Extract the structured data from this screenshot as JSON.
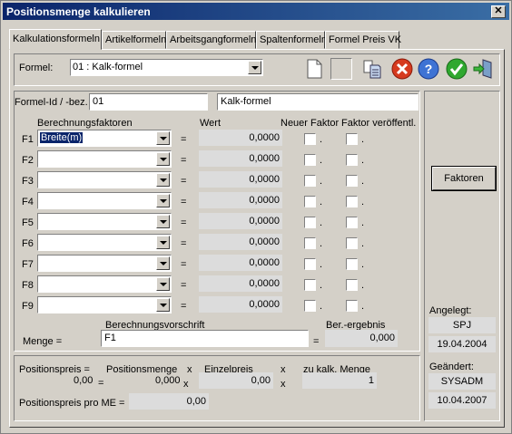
{
  "window": {
    "title": "Positionsmenge kalkulieren",
    "close_symbol": "✕"
  },
  "tabs": [
    {
      "label": "Kalkulationsformeln"
    },
    {
      "label": "Artikelformeln"
    },
    {
      "label": "Arbeitsgangformeln"
    },
    {
      "label": "Spaltenformeln"
    },
    {
      "label": "Formel Preis VK"
    }
  ],
  "formel": {
    "label": "Formel:",
    "value": "01 : Kalk-formel"
  },
  "toolbar": {
    "icons": [
      "new-document-icon",
      "blank-icon",
      "copy-icon",
      "delete-icon",
      "help-icon",
      "confirm-icon",
      "exit-icon"
    ],
    "delete_symbol": "✕",
    "help_symbol": "?",
    "confirm_symbol": "✔"
  },
  "formel_id": {
    "label": "Formel-Id / -bez.",
    "id": "01",
    "bez": "Kalk-formel"
  },
  "headers": {
    "berechnungsfaktoren": "Berechnungsfaktoren",
    "wert": "Wert",
    "neuer_faktor": "Neuer Faktor",
    "faktor_veroeffentl": "Faktor veröffentl."
  },
  "factors": [
    {
      "label": "F1",
      "value": "Breite(m)",
      "wert": "0,0000",
      "eq": "="
    },
    {
      "label": "F2",
      "value": "",
      "wert": "0,0000",
      "eq": "="
    },
    {
      "label": "F3",
      "value": "",
      "wert": "0,0000",
      "eq": "="
    },
    {
      "label": "F4",
      "value": "",
      "wert": "0,0000",
      "eq": "="
    },
    {
      "label": "F5",
      "value": "",
      "wert": "0,0000",
      "eq": "="
    },
    {
      "label": "F6",
      "value": "",
      "wert": "0,0000",
      "eq": "="
    },
    {
      "label": "F7",
      "value": "",
      "wert": "0,0000",
      "eq": "="
    },
    {
      "label": "F8",
      "value": "",
      "wert": "0,0000",
      "eq": "="
    },
    {
      "label": "F9",
      "value": "",
      "wert": "0,0000",
      "eq": "="
    }
  ],
  "checkbox_dot": ".",
  "berechnung": {
    "vorschrift_label": "Berechnungsvorschrift",
    "menge_label": "Menge =",
    "vorschrift_value": "F1",
    "eq": "=",
    "ergebnis_label": "Ber.-ergebnis",
    "ergebnis_value": "0,000"
  },
  "buttons": {
    "faktoren": "Faktoren"
  },
  "side": {
    "angelegt_label": "Angelegt:",
    "angelegt_user": "SPJ",
    "angelegt_date": "19.04.2004",
    "geaendert_label": "Geändert:",
    "geaendert_user": "SYSADM",
    "geaendert_date": "10.04.2007"
  },
  "bottom": {
    "positionspreis_label": "Positionspreis =",
    "positionspreis_value": "0,00",
    "eq": "=",
    "positionsmenge_label": "Positionsmenge",
    "positionsmenge_value": "0,000",
    "x": "x",
    "einzelpreis_label": "Einzelpreis",
    "einzelpreis_value": "0,00",
    "zu_kalk_label": "zu kalk. Menge",
    "zu_kalk_value": "1",
    "pro_me_label": "Positionspreis pro ME =",
    "pro_me_value": "0,00"
  }
}
